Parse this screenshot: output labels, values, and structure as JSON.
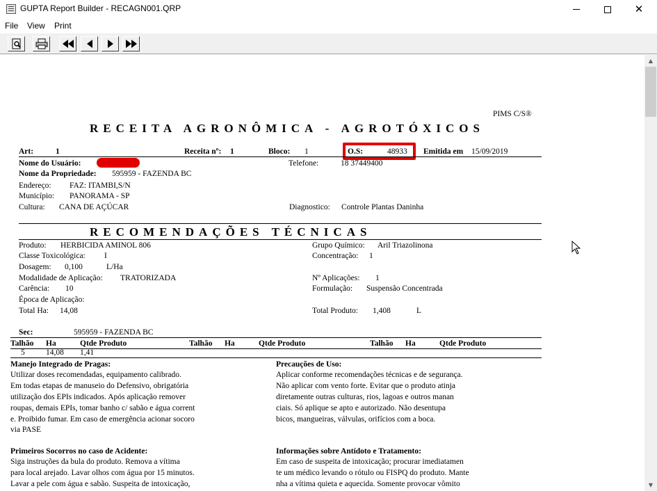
{
  "window": {
    "title": "GUPTA Report Builder - RECAGN001.QRP",
    "minimize": "–",
    "maximize": "☐",
    "close": "✕"
  },
  "menu": [
    "File",
    "View",
    "Print"
  ],
  "scrollbar": {
    "up": "▲",
    "down": "▼"
  },
  "report": {
    "brand": "PIMS C/S®",
    "title": "RECEITA  AGRONÔMICA - AGROTÓXICOS",
    "header": {
      "art_label": "Art:",
      "art_value": "1",
      "receita_label": "Receita nº:",
      "receita_value": "1",
      "bloco_label": "Bloco:",
      "bloco_value": "1",
      "os_label": "O.S:",
      "os_value": "48933",
      "emitida_label": "Emitida em",
      "emitida_value": "15/09/2019"
    },
    "info": {
      "usuario_label": "Nome do Usuário:",
      "telefone_label": "Telefone:",
      "telefone_value": "18 37449400",
      "propriedade_label": "Nome da Propriedade:",
      "propriedade_value": "595959 - FAZENDA BC",
      "endereco_label": "Endereço:",
      "endereco_value": "FAZ: ITAMBI,S/N",
      "municipio_label": "Município:",
      "municipio_value": "PANORAMA - SP",
      "cultura_label": "Cultura:",
      "cultura_value": "CANA DE AÇÚCAR",
      "diagnostico_label": "Diagnostico:",
      "diagnostico_value": "Controle Plantas Daninha"
    },
    "rec_title": "RECOMENDAÇÕES  TÉCNICAS",
    "rec": {
      "produto_label": "Produto:",
      "produto_value": "HERBICIDA AMINOL 806",
      "grupo_label": "Grupo Químico:",
      "grupo_value": "Aril Triazolinona",
      "classe_label": "Classe Toxicológica:",
      "classe_value": "I",
      "concentracao_label": "Concentração:",
      "concentracao_value": "1",
      "dosagem_label": "Dosagem:",
      "dosagem_value": "0,100",
      "dosagem_unit": "L/Ha",
      "modalidade_label": "Modalidade de Aplicação:",
      "modalidade_value": "TRATORIZADA",
      "aplicacoes_label": "Nº Aplicações:",
      "aplicacoes_value": "1",
      "carencia_label": "Carência:",
      "carencia_value": "10",
      "formulacao_label": "Formulação:",
      "formulacao_value": "Suspensão Concentrada",
      "epoca_label": "Época de Aplicação:",
      "totalha_label": "Total Ha:",
      "totalha_value": "14,08",
      "totalprod_label": "Total Produto:",
      "totalprod_value": "1,408",
      "totalprod_unit": "L"
    },
    "sec": {
      "label": "Sec:",
      "value": "595959 - FAZENDA BC"
    },
    "table": {
      "headers": [
        "Talhão",
        "Ha",
        "Qtde Produto",
        "Talhão",
        "Ha",
        "Qtde Produto",
        "Talhão",
        "Ha",
        "Qtde Produto"
      ],
      "row": [
        "5",
        "14,08",
        "1,41"
      ]
    },
    "sections": {
      "manejo_title": "Manejo Integrado de Pragas:",
      "manejo_lines": [
        "Utilizar doses recomendadas, equipamento calibrado.",
        "Em todas etapas de manuseio do Defensivo, obrigatória",
        "utilização dos EPIs indicados. Após aplicação remover",
        "roupas, demais EPIs, tomar banho c/ sabão e água corrent",
        "e. Proibido fumar. Em caso de emergência acionar socoro",
        "via PASE"
      ],
      "precaucoes_title": "Precauções de Uso:",
      "precaucoes_lines": [
        "Aplicar conforme recomendações técnicas e de segurança.",
        "Não aplicar com vento forte. Evitar que o produto atinja",
        "diretamente outras culturas, rios, lagoas e outros manan",
        "ciais. Só aplique se apto e autorizado. Não desentupa",
        "bicos, mangueiras, válvulas, orifícios com a boca."
      ],
      "socorros_title": "Primeiros Socorros no caso de Acidente:",
      "socorros_lines": [
        "Siga instruções da bula do produto. Remova a vítima",
        "para local arejado. Lavar olhos com água por 15 minutos.",
        "Lavar a pele com água e sabão. Suspeita de intoxicação,"
      ],
      "antidoto_title": "Informações sobre Antídoto e Tratamento:",
      "antidoto_lines": [
        "Em caso de suspeita de intoxicação; procurar imediatamen",
        "te um médico levando o rótulo ou FISPQ do produto. Mante",
        "nha a vítima quieta e aquecida. Somente provocar vômito"
      ]
    }
  }
}
